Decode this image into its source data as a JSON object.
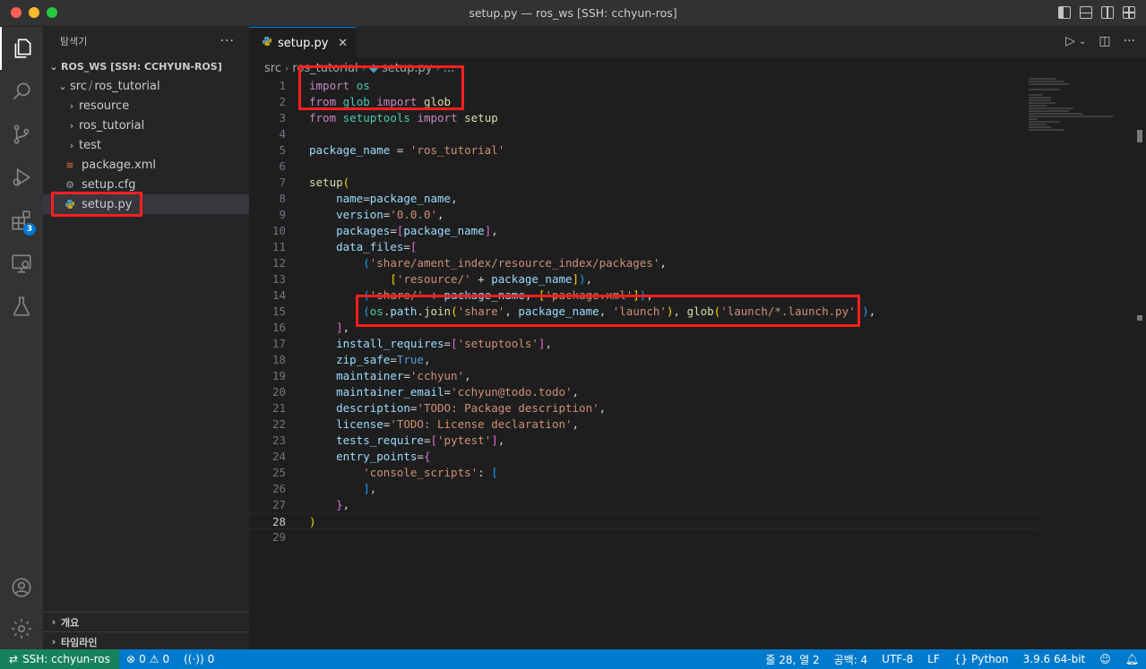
{
  "window": {
    "title": "setup.py — ros_ws [SSH: cchyun-ros]"
  },
  "sidebar": {
    "header": "탐색기",
    "more": "···",
    "root_folder": "ROS_WS [SSH: CCHYUN-ROS]",
    "path": "src",
    "path_sep": "/",
    "path2": "ros_tutorial",
    "items": [
      {
        "label": "resource",
        "type": "folder"
      },
      {
        "label": "ros_tutorial",
        "type": "folder"
      },
      {
        "label": "test",
        "type": "folder"
      },
      {
        "label": "package.xml",
        "type": "file"
      },
      {
        "label": "setup.cfg",
        "type": "file"
      },
      {
        "label": "setup.py",
        "type": "file",
        "selected": true
      }
    ],
    "outline": "개요",
    "timeline": "타임라인"
  },
  "activity": {
    "extensions_badge": "3"
  },
  "editor": {
    "tab_label": "setup.py",
    "breadcrumb": [
      "src",
      "ros_tutorial",
      "setup.py",
      "..."
    ],
    "current_line": 28,
    "lines": [
      {
        "n": "1"
      },
      {
        "n": "2"
      },
      {
        "n": "3"
      },
      {
        "n": "4"
      },
      {
        "n": "5"
      },
      {
        "n": "6"
      },
      {
        "n": "7"
      },
      {
        "n": "8"
      },
      {
        "n": "9"
      },
      {
        "n": "10"
      },
      {
        "n": "11"
      },
      {
        "n": "12"
      },
      {
        "n": "13"
      },
      {
        "n": "14"
      },
      {
        "n": "15"
      },
      {
        "n": "16"
      },
      {
        "n": "17"
      },
      {
        "n": "18"
      },
      {
        "n": "19"
      },
      {
        "n": "20"
      },
      {
        "n": "21"
      },
      {
        "n": "22"
      },
      {
        "n": "23"
      },
      {
        "n": "24"
      },
      {
        "n": "25"
      },
      {
        "n": "26"
      },
      {
        "n": "27"
      },
      {
        "n": "28"
      },
      {
        "n": "29"
      }
    ]
  },
  "statusbar": {
    "remote": "SSH: cchyun-ros",
    "errors": "0",
    "warnings": "0",
    "ports": "0",
    "position": "줄 28, 열 2",
    "spaces": "공백: 4",
    "encoding": "UTF-8",
    "eol": "LF",
    "language": "Python",
    "interpreter": "3.9.6 64-bit"
  },
  "colors": {
    "accent": "#007acc",
    "remote": "#16825d",
    "highlight_box": "#ff1f1f"
  }
}
